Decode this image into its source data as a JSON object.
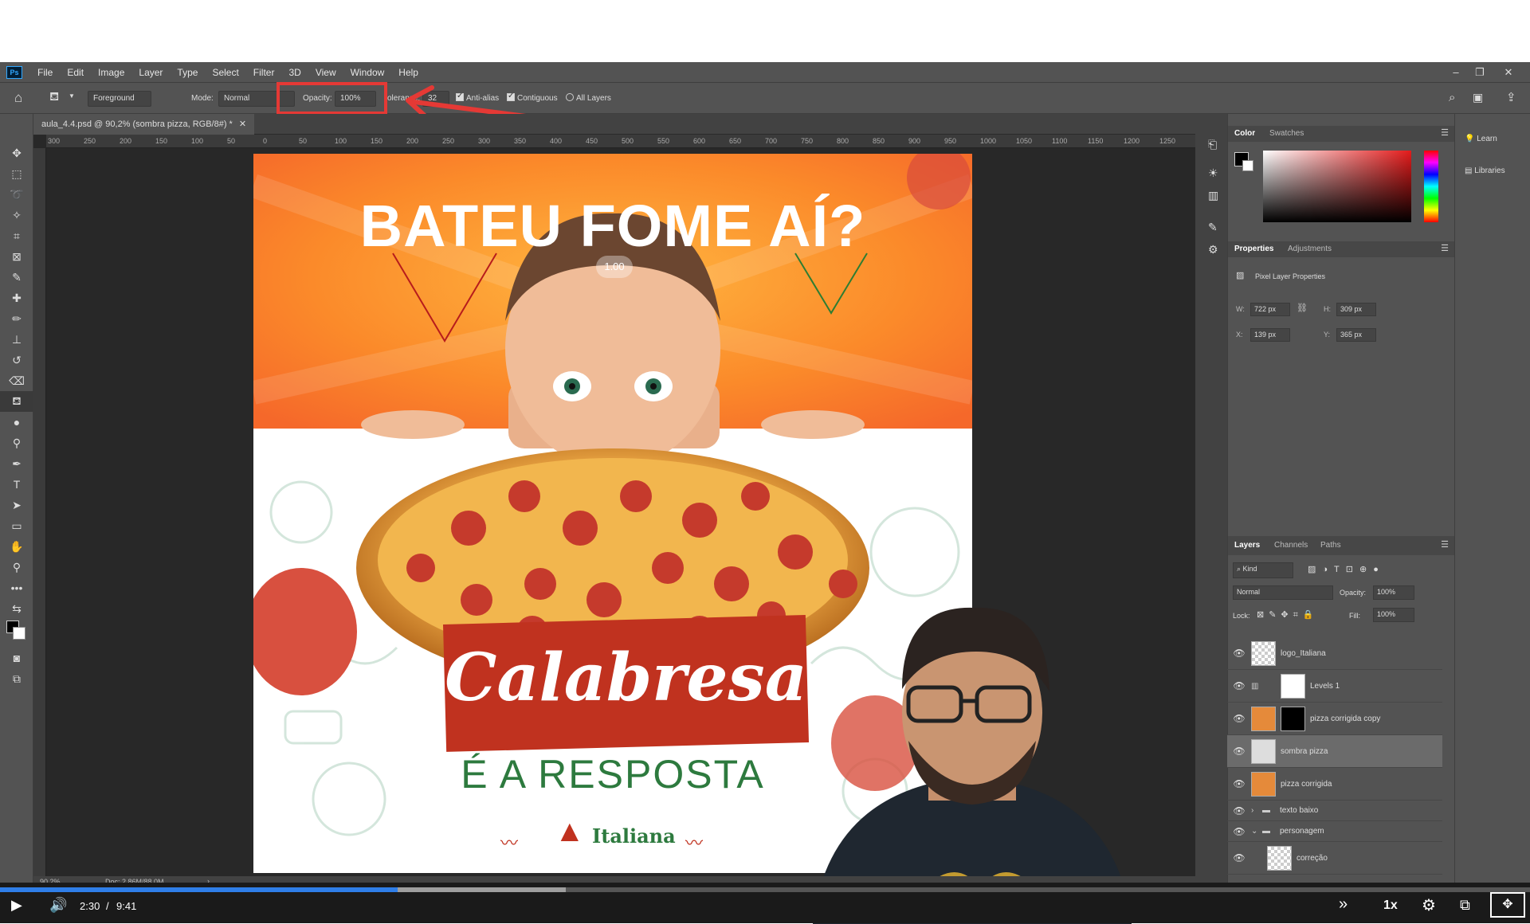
{
  "menubar": {
    "app_icon": "Ps",
    "items": [
      "File",
      "Edit",
      "Image",
      "Layer",
      "Type",
      "Select",
      "Filter",
      "3D",
      "View",
      "Window",
      "Help"
    ]
  },
  "options_bar": {
    "fill_source": "Foreground",
    "mode_label": "Mode:",
    "mode_value": "Normal",
    "opacity_label": "Opacity:",
    "opacity_value": "100%",
    "tolerance_label": "olerance:",
    "tolerance_value": "32",
    "anti_alias": "Anti-alias",
    "contiguous": "Contiguous",
    "all_layers": "All Layers"
  },
  "document": {
    "tab_title": "aula_4.4.psd @ 90,2% (sombra pizza, RGB/8#) *",
    "zoom": "90,2%",
    "doc_info": "Doc: 2,86M/88,0M",
    "ruler_ticks": [
      "300",
      "250",
      "200",
      "150",
      "100",
      "50",
      "0",
      "50",
      "100",
      "150",
      "200",
      "250",
      "300",
      "350",
      "400",
      "450",
      "500",
      "550",
      "600",
      "650",
      "700",
      "750",
      "800",
      "850",
      "900",
      "950",
      "1000",
      "1050",
      "1100",
      "1150",
      "1200",
      "1250"
    ],
    "overlay_value": "1.00"
  },
  "artwork": {
    "headline": "BATEU FOME AÍ?",
    "banner": "Calabresa",
    "subline": "É A RESPOSTA",
    "logo": "Italiana"
  },
  "color_panel": {
    "tabs": [
      "Color",
      "Swatches"
    ]
  },
  "properties_panel": {
    "tabs": [
      "Properties",
      "Adjustments"
    ],
    "title": "Pixel Layer Properties",
    "w_label": "W:",
    "w_value": "722 px",
    "h_label": "H:",
    "h_value": "309 px",
    "x_label": "X:",
    "x_value": "139 px",
    "y_label": "Y:",
    "y_value": "365 px"
  },
  "layers_panel": {
    "tabs": [
      "Layers",
      "Channels",
      "Paths"
    ],
    "filter_kind": "Kind",
    "blend_mode": "Normal",
    "opacity_label": "Opacity:",
    "opacity_value": "100%",
    "lock_label": "Lock:",
    "fill_label": "Fill:",
    "fill_value": "100%",
    "layers": [
      "logo_Italiana",
      "Levels 1",
      "pizza corrigida copy",
      "sombra pizza",
      "pizza corrigida",
      "texto baixo",
      "personagem",
      "correção"
    ]
  },
  "learn_panel": {
    "items": [
      "Learn",
      "Libraries"
    ]
  },
  "player": {
    "current_time": "2:30",
    "separator": "/",
    "total_time": "9:41",
    "speed": "1x",
    "progress": 0.26,
    "buffered": 0.37
  },
  "colors": {
    "accent_red": "#e53935",
    "progress_blue": "#2f7ee8",
    "ps_bg": "#535353"
  }
}
